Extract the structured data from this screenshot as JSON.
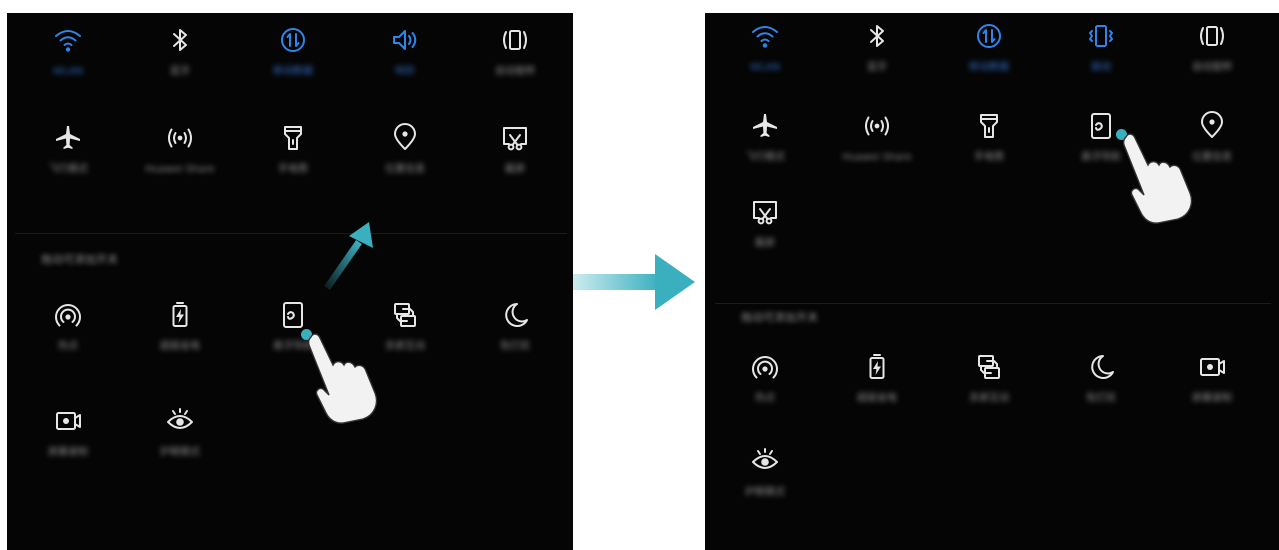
{
  "left": {
    "top_row": [
      {
        "id": "wlan",
        "label": "WLAN",
        "icon": "wifi-icon",
        "active": true
      },
      {
        "id": "bluetooth",
        "label": "蓝牙",
        "icon": "bluetooth-icon",
        "active": false
      },
      {
        "id": "mobile-data",
        "label": "移动数据",
        "icon": "mobile-data-icon",
        "active": true
      },
      {
        "id": "sound",
        "label": "响铃",
        "icon": "sound-icon",
        "active": true
      },
      {
        "id": "auto-rotate",
        "label": "自动旋转",
        "icon": "auto-rotate-icon",
        "active": false
      }
    ],
    "second_row": [
      {
        "id": "airplane",
        "label": "飞行模式",
        "icon": "airplane-icon"
      },
      {
        "id": "huawei-share",
        "label": "Huawei Share",
        "icon": "huawei-share-icon"
      },
      {
        "id": "flashlight",
        "label": "手电筒",
        "icon": "flashlight-icon"
      },
      {
        "id": "location",
        "label": "位置信息",
        "icon": "location-icon"
      },
      {
        "id": "screenshot",
        "label": "截屏",
        "icon": "screenshot-icon"
      }
    ],
    "section_title": "拖动可添加开关",
    "extra_row1": [
      {
        "id": "hotspot",
        "label": "热点",
        "icon": "hotspot-icon"
      },
      {
        "id": "ultra-power",
        "label": "超级省电",
        "icon": "battery-icon"
      },
      {
        "id": "floating-dock",
        "label": "悬浮导航",
        "icon": "floating-dock-icon"
      },
      {
        "id": "multi-screen",
        "label": "多屏互动",
        "icon": "multi-screen-icon"
      },
      {
        "id": "do-not-disturb",
        "label": "免打扰",
        "icon": "moon-icon"
      }
    ],
    "extra_row2": [
      {
        "id": "screen-record",
        "label": "屏幕录制",
        "icon": "screen-record-icon"
      },
      {
        "id": "eye-comfort",
        "label": "护眼模式",
        "icon": "eye-icon"
      }
    ]
  },
  "right": {
    "top_row": [
      {
        "id": "wlan",
        "label": "WLAN",
        "icon": "wifi-icon",
        "active": true
      },
      {
        "id": "bluetooth",
        "label": "蓝牙",
        "icon": "bluetooth-icon",
        "active": false
      },
      {
        "id": "mobile-data",
        "label": "移动数据",
        "icon": "mobile-data-icon",
        "active": true
      },
      {
        "id": "vibrate",
        "label": "振动",
        "icon": "vibrate-icon",
        "active": true
      },
      {
        "id": "auto-rotate",
        "label": "自动旋转",
        "icon": "auto-rotate-icon",
        "active": false
      }
    ],
    "second_row": [
      {
        "id": "airplane",
        "label": "飞行模式",
        "icon": "airplane-icon"
      },
      {
        "id": "huawei-share",
        "label": "Huawei Share",
        "icon": "huawei-share-icon"
      },
      {
        "id": "flashlight",
        "label": "手电筒",
        "icon": "flashlight-icon"
      },
      {
        "id": "floating-dock",
        "label": "悬浮导航",
        "icon": "floating-dock-icon"
      },
      {
        "id": "location",
        "label": "位置信息",
        "icon": "location-icon"
      }
    ],
    "third_row": [
      {
        "id": "screenshot",
        "label": "截屏",
        "icon": "screenshot-icon"
      }
    ],
    "section_title": "拖动可添加开关",
    "extra_row1": [
      {
        "id": "hotspot",
        "label": "热点",
        "icon": "hotspot-icon"
      },
      {
        "id": "ultra-power",
        "label": "超级省电",
        "icon": "battery-icon"
      },
      {
        "id": "multi-screen",
        "label": "多屏互动",
        "icon": "multi-screen-icon"
      },
      {
        "id": "do-not-disturb",
        "label": "免打扰",
        "icon": "moon-icon"
      },
      {
        "id": "screen-record",
        "label": "屏幕录制",
        "icon": "screen-record-icon"
      }
    ],
    "extra_row2": [
      {
        "id": "eye-comfort",
        "label": "护眼模式",
        "icon": "eye-icon"
      }
    ]
  },
  "colors": {
    "active": "#2f86ea",
    "inactive": "#e6e6e6",
    "accent_arrow": "#3ab0bf",
    "panel": "#050505"
  }
}
